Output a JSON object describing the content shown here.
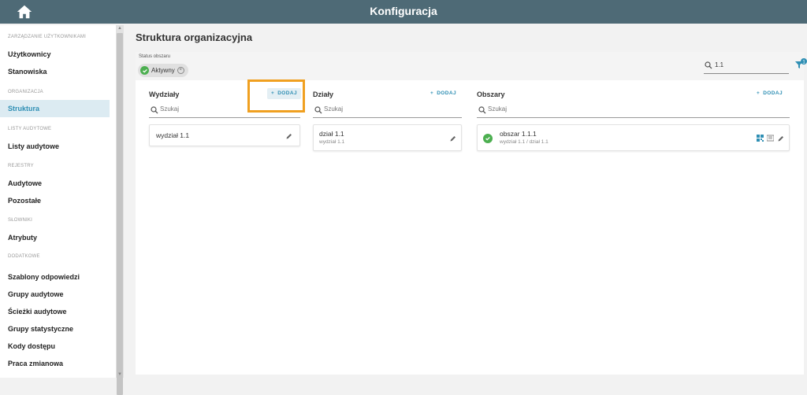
{
  "header": {
    "title": "Konfiguracja"
  },
  "sidebar": {
    "sections": [
      {
        "heading": "ZARZĄDZANIE UŻYTKOWNIKAMI",
        "items": [
          "Użytkownicy",
          "Stanowiska"
        ]
      },
      {
        "heading": "ORGANIZACJA",
        "items": [
          "Struktura"
        ]
      },
      {
        "heading": "LISTY AUDYTOWE",
        "items": [
          "Listy audytowe"
        ]
      },
      {
        "heading": "REJESTRY",
        "items": [
          "Audytowe",
          "Pozostałe"
        ]
      },
      {
        "heading": "SŁOWNIKI",
        "items": [
          "Atrybuty"
        ]
      },
      {
        "heading": "DODATKOWE",
        "items": [
          "Szablony odpowiedzi",
          "Grupy audytowe",
          "Ścieżki audytowe",
          "Grupy statystyczne",
          "Kody dostępu",
          "Praca zmianowa"
        ]
      }
    ],
    "active_item": "Struktura"
  },
  "page": {
    "title": "Struktura organizacyjna"
  },
  "filters": {
    "status_label": "Status obszaru",
    "status_chip": "Aktywny",
    "search_value": "1.1",
    "filter_badge": "1"
  },
  "columns": {
    "wydzialy": {
      "title": "Wydziały",
      "add_label": "DODAJ",
      "add_plus": "+",
      "search_placeholder": "Szukaj",
      "card": {
        "title": "wydział 1.1"
      }
    },
    "dzialy": {
      "title": "Działy",
      "add_label": "DODAJ",
      "add_plus": "+",
      "search_placeholder": "Szukaj",
      "card": {
        "title": "dział 1.1",
        "subtitle": "wydział 1.1"
      }
    },
    "obszary": {
      "title": "Obszary",
      "add_label": "DODAJ",
      "add_plus": "+",
      "search_placeholder": "Szukaj",
      "card": {
        "title": "obszar 1.1.1",
        "subtitle": "wydział 1.1 / dział 1.1"
      }
    }
  },
  "colors": {
    "topbar": "#4e6a76",
    "accent": "#2f8fb4",
    "success": "#4caf50",
    "highlight": "#f0a020",
    "active_bg": "#dcebf2"
  }
}
